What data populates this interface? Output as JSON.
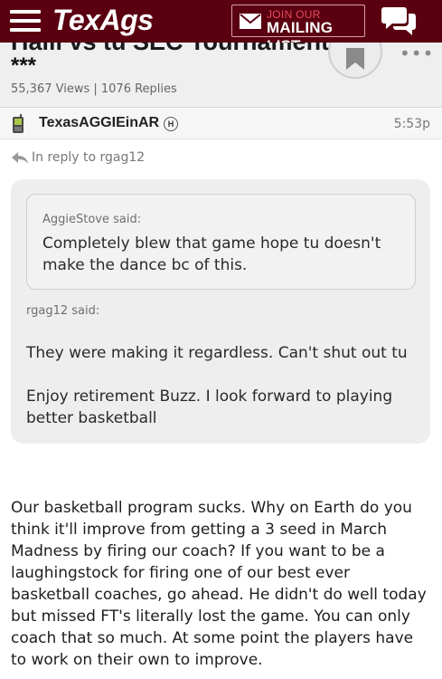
{
  "header": {
    "logo": "TexAgs",
    "mailing_join": "JOIN OUR",
    "mailing_list": "MAILING LIST"
  },
  "thread": {
    "title": "Halli vs tu SEC Tournament",
    "stars": "***",
    "stats": "55,367 Views | 1076 Replies"
  },
  "post": {
    "username": "TexasAGGIEinAR",
    "badge": "H",
    "time": "5:53p",
    "in_reply_to": "In reply to rgag12",
    "nested_quote": {
      "author": "AggieStove said:",
      "text": "Completely blew that game hope tu doesn't make the dance bc of this."
    },
    "quote": {
      "author": "rgag12 said:",
      "line1": "They were making it regardless. Can't shut out tu",
      "line2": "Enjoy retirement Buzz. I look forward to playing better basketball"
    },
    "body": "Our basketball program sucks. Why on Earth do you think it'll improve from getting a 3 seed in March Madness by firing our coach? If you want to be a laughingstock for firing one of our best ever basketball coaches, go ahead. He didn't do well today but missed FT's literally lost the game. You can only coach that so much. At some point the players have to work on their own to improve."
  },
  "colors": {
    "topbar": "#5a0010",
    "accent_red": "#e84b5e",
    "quote_bg": "#eeeeee"
  },
  "icons": [
    "hamburger-menu-icon",
    "envelope-icon",
    "chat-bubbles-icon",
    "bookmark-icon",
    "more-icon",
    "phone-icon",
    "reply-arrow-icon"
  ]
}
